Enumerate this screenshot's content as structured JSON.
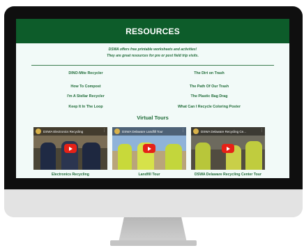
{
  "header": {
    "title": "RESOURCES"
  },
  "intro": {
    "line1": "DSWA offers free printable worksheets and activities!",
    "line2": "They are great resources for pre or post field trip visits."
  },
  "resources": {
    "left": [
      "DINO-Mite Recycler",
      "How To Compost",
      "I'm A Stellar Recycler",
      "Keep It In The Loop"
    ],
    "right": [
      "The Dirt on Trash",
      "The Path Of Our Trash",
      "The Plastic Bag Drag",
      "What Can I Recycle Coloring Poster"
    ]
  },
  "virtual_tours": {
    "title": "Virtual Tours",
    "videos": [
      {
        "thumb_title": "DSWA Electronics Recycling",
        "caption": "Electronics Recycling"
      },
      {
        "thumb_title": "DSWA Delaware Landfill Tour",
        "caption": "Landfill Tour"
      },
      {
        "thumb_title": "DSWA Delaware Recycling Ce...",
        "caption": "DSWA Delaware Recycling Center Tour"
      }
    ]
  },
  "colors": {
    "header_bg": "#0d5c2a",
    "link": "#1e6b37",
    "play_button": "#e62117",
    "page_bg": "#f2faf8"
  }
}
